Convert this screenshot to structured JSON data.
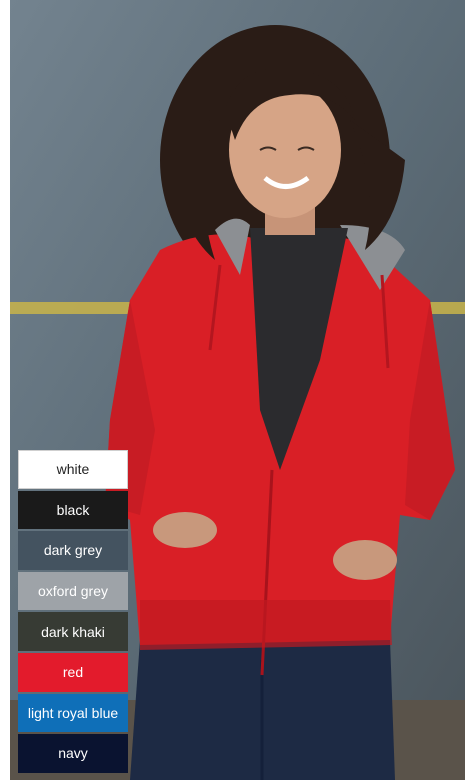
{
  "colors": [
    {
      "label": "white",
      "hex": "#ffffff"
    },
    {
      "label": "black",
      "hex": "#1a1a1a"
    },
    {
      "label": "dark grey",
      "hex": "#445360"
    },
    {
      "label": "oxford grey",
      "hex": "#9ea3a8"
    },
    {
      "label": "dark khaki",
      "hex": "#373b34"
    },
    {
      "label": "red",
      "hex": "#e31b2c"
    },
    {
      "label": "light royal blue",
      "hex": "#0f6fb8"
    },
    {
      "label": "navy",
      "hex": "#0a1330"
    }
  ],
  "photo": {
    "garment_color": "#d91f26",
    "hood_lining_color": "#8c8f93",
    "undershirt_color": "#2b2b2e",
    "jeans_color": "#1d2a44"
  }
}
